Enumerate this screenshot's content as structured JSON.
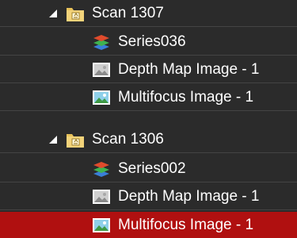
{
  "tree": {
    "nodes": [
      {
        "label": "Scan 1307",
        "icon": "scan-folder-icon",
        "expanded": true
      },
      {
        "label": "Series036",
        "icon": "layers-stack-icon"
      },
      {
        "label": "Depth Map Image - 1",
        "icon": "image-icon"
      },
      {
        "label": "Multifocus Image - 1",
        "icon": "image-icon"
      },
      {
        "label": "Scan 1306",
        "icon": "scan-folder-icon",
        "expanded": true
      },
      {
        "label": "Series002",
        "icon": "layers-stack-icon"
      },
      {
        "label": "Depth Map Image - 1",
        "icon": "image-icon"
      },
      {
        "label": "Multifocus Image - 1",
        "icon": "image-icon",
        "selected": true
      }
    ]
  },
  "colors": {
    "background": "#2b2b2b",
    "selection": "#b01010",
    "separator": "#444444",
    "text": "#ffffff"
  }
}
